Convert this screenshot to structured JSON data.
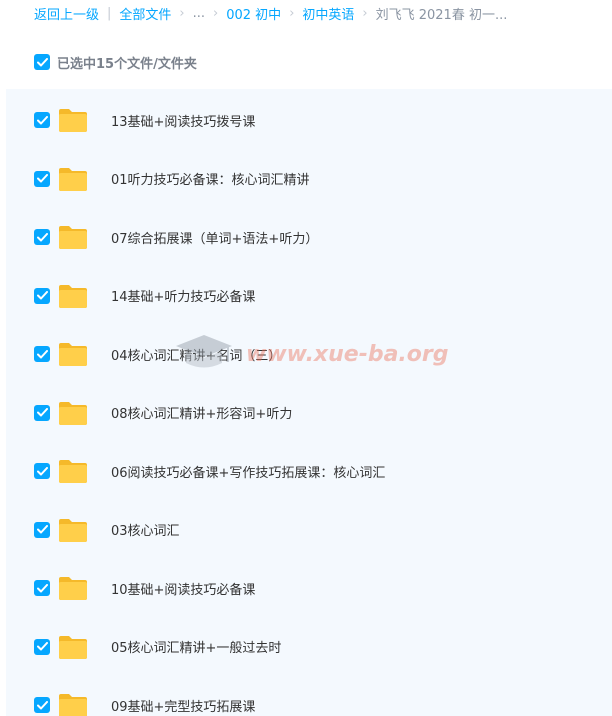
{
  "breadcrumb": {
    "back": "返回上一级",
    "all_files": "全部文件",
    "ellipsis": "...",
    "level1": "002 初中",
    "level2": "初中英语",
    "current": "刘飞飞 2021春 初一..."
  },
  "selection": {
    "label": "已选中15个文件/文件夹"
  },
  "files": [
    {
      "name": "13基础+阅读技巧拨号课"
    },
    {
      "name": "01听力技巧必备课：核心词汇精讲"
    },
    {
      "name": "07综合拓展课（单词+语法+听力）"
    },
    {
      "name": "14基础+听力技巧必备课"
    },
    {
      "name": "04核心词汇精讲+名词（三）"
    },
    {
      "name": "08核心词汇精讲+形容词+听力"
    },
    {
      "name": "06阅读技巧必备课+写作技巧拓展课：核心词汇"
    },
    {
      "name": "03核心词汇"
    },
    {
      "name": "10基础+阅读技巧必备课"
    },
    {
      "name": "05核心词汇精讲+一般过去时"
    },
    {
      "name": "09基础+完型技巧拓展课"
    }
  ],
  "watermark": {
    "text": "www.xue-ba.org"
  },
  "colors": {
    "accent": "#06a7ff",
    "folder": "#ffc93c",
    "list_bg": "#f4f9fe"
  },
  "icons": {
    "checkbox": "checkmark-icon",
    "folder": "folder-icon",
    "watermark": "graduation-cap-icon"
  }
}
